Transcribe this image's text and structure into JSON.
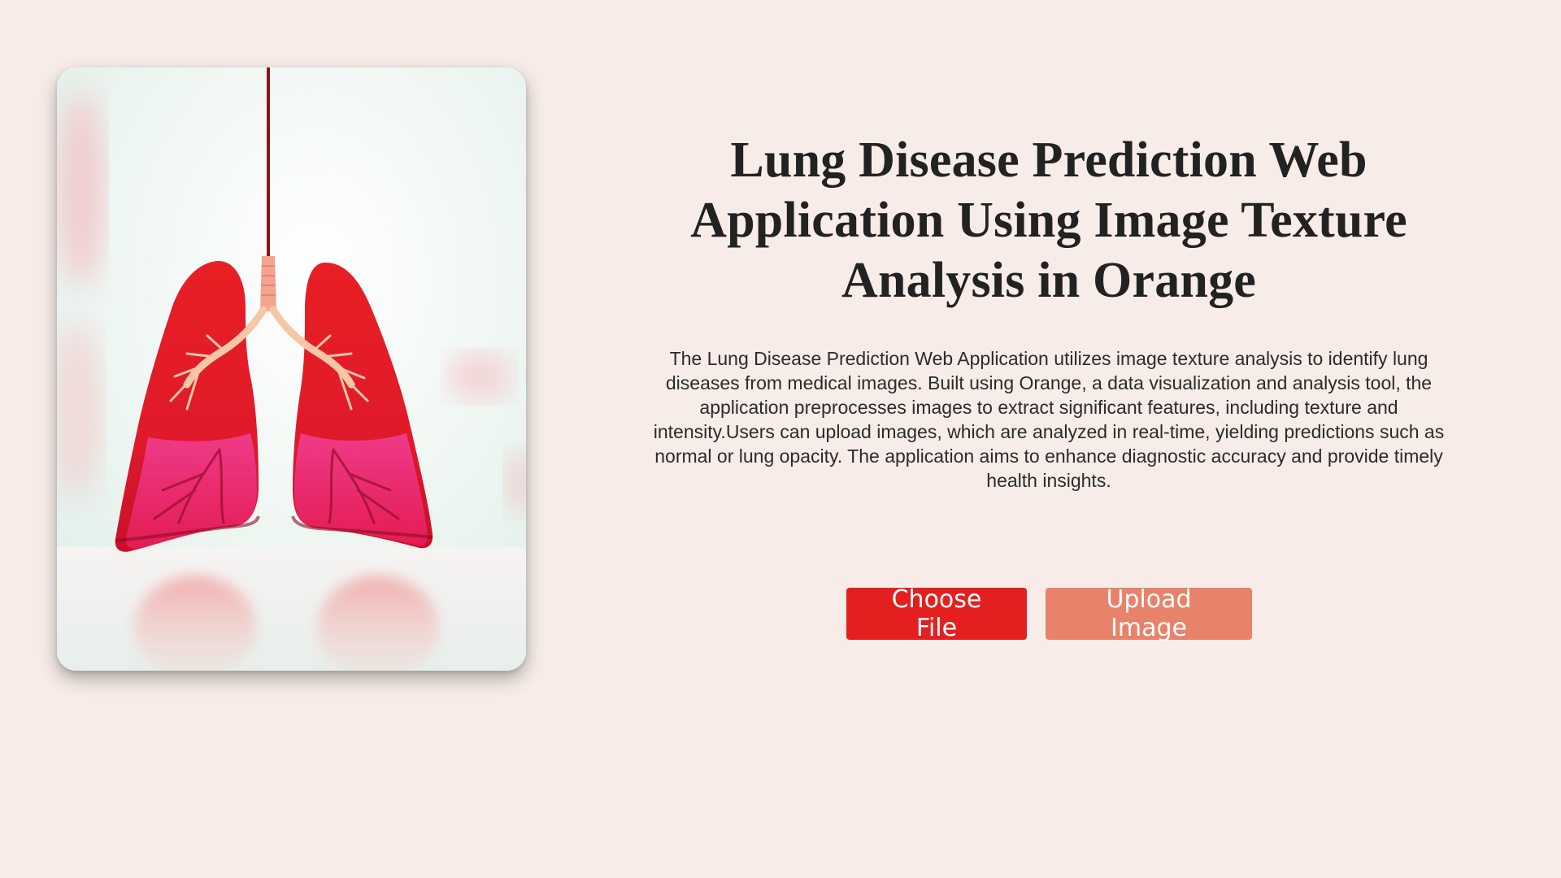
{
  "page": {
    "title": "Lung Disease Prediction Web Application Using Image Texture Analysis in Orange",
    "description": "The Lung Disease Prediction Web Application utilizes image texture analysis to identify lung diseases from medical images. Built using Orange, a data visualization and analysis tool, the application preprocesses images to extract significant features, including texture and intensity.Users can upload images, which are analyzed in real-time, yielding predictions such as normal or lung opacity. The application aims to enhance diagnostic accuracy and provide timely health insights."
  },
  "actions": {
    "choose_file_label": "Choose File",
    "upload_image_label": "Upload Image"
  },
  "colors": {
    "background": "#f7ece8",
    "choose_button": "#e3201f",
    "upload_button": "#e9826a",
    "text": "#222222"
  },
  "image": {
    "subject": "lungs-illustration"
  }
}
